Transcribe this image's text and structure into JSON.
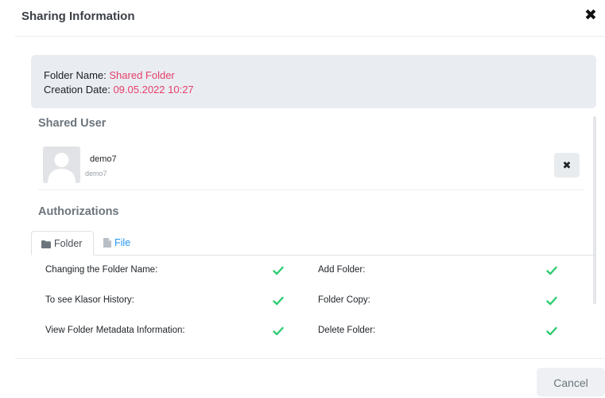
{
  "modal": {
    "title": "Sharing Information",
    "close_glyph": "✖"
  },
  "info": {
    "folder_name_label": "Folder Name:",
    "folder_name_value": "Shared Folder",
    "creation_date_label": "Creation Date:",
    "creation_date_value": "09.05.2022 10:27"
  },
  "shared_user": {
    "section_title": "Shared User",
    "user_name": "demo7",
    "user_sub": "demo7",
    "remove_glyph": "✖"
  },
  "authorizations": {
    "section_title": "Authorizations",
    "tabs": [
      {
        "label": "Folder",
        "icon": "folder-icon",
        "active": true
      },
      {
        "label": "File",
        "icon": "file-icon",
        "active": false
      }
    ],
    "permissions": [
      {
        "label": "Changing the Folder Name:",
        "granted": true
      },
      {
        "label": "Add Folder:",
        "granted": true
      },
      {
        "label": "To see Klasor History:",
        "granted": true
      },
      {
        "label": "Folder Copy:",
        "granted": true
      },
      {
        "label": "View Folder Metadata Information:",
        "granted": true
      },
      {
        "label": "Delete Folder:",
        "granted": true
      }
    ]
  },
  "footer": {
    "cancel_label": "Cancel"
  },
  "colors": {
    "accent_pink": "#e83e6c",
    "check_green": "#2ecc71",
    "link_blue": "#2196f3"
  }
}
